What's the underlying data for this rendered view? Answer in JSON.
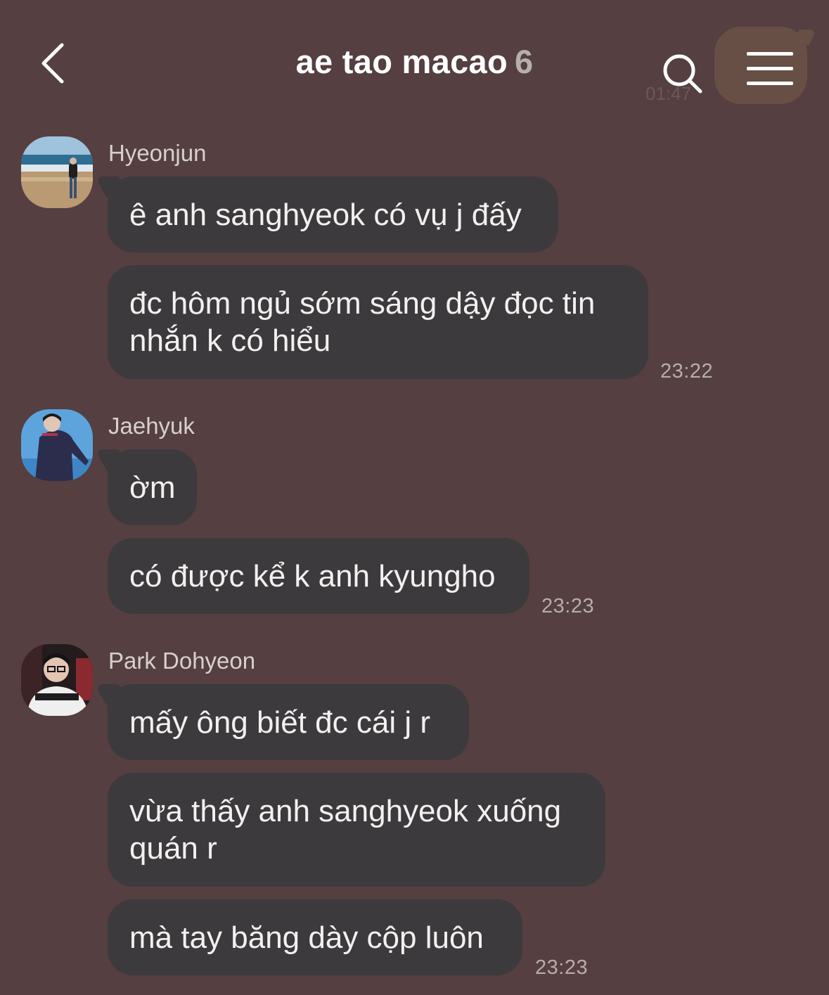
{
  "header": {
    "title": "ae tao macao",
    "member_count": "6",
    "back_icon": "chevron-left-icon",
    "search_icon": "search-icon",
    "menu_icon": "hamburger-menu-icon",
    "background_bubble_time": "01:47"
  },
  "colors": {
    "background": "#553f40",
    "bubble": "#3c3a3c",
    "text": "#f4f0f0",
    "time_text": "#b7acad"
  },
  "groups": [
    {
      "sender": "Hyeonjun",
      "messages": [
        "ê anh sanghyeok có vụ j đấy",
        "đc hôm ngủ sớm sáng dậy đọc tin nhắn k có hiểu"
      ],
      "time": "23:22"
    },
    {
      "sender": "Jaehyuk",
      "messages": [
        "ờm",
        "có được kể k anh kyungho"
      ],
      "time": "23:23"
    },
    {
      "sender": "Park Dohyeon",
      "messages": [
        "mấy ông biết đc cái j r",
        "vừa thấy anh sanghyeok xuống quán r",
        "mà tay băng dày cộp luôn"
      ],
      "time": "23:23"
    }
  ]
}
